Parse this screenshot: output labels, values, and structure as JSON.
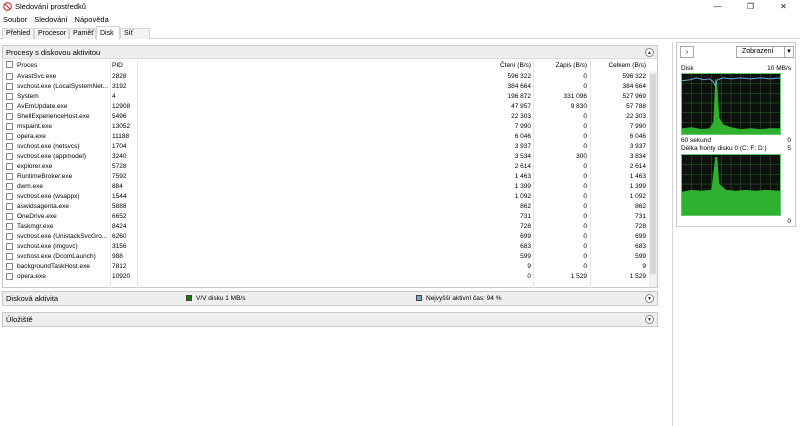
{
  "window": {
    "title": "Sledování prostředků",
    "controls": [
      "—",
      "❐",
      "✕"
    ]
  },
  "menu": [
    "Soubor",
    "Sledování",
    "Nápověda"
  ],
  "tabs": [
    "Přehled",
    "Procesor",
    "Paměť",
    "Disk",
    "Síť"
  ],
  "active_tab": "Disk",
  "processes_section": {
    "title": "Procesy s diskovou aktivitou",
    "columns": {
      "process": "Proces",
      "pid": "PID",
      "read": "Čtení (B/s)",
      "write": "Zápis (B/s)",
      "total": "Celkem (B/s)"
    },
    "rows": [
      {
        "name": "AvastSvc.exe",
        "pid": "2828",
        "read": "596 322",
        "write": "0",
        "total": "596 322"
      },
      {
        "name": "svchost.exe (LocalSystemNet...",
        "pid": "3192",
        "read": "384 664",
        "write": "0",
        "total": "384 664"
      },
      {
        "name": "System",
        "pid": "4",
        "read": "196 872",
        "write": "331 096",
        "total": "527 969"
      },
      {
        "name": "AvEmUpdate.exe",
        "pid": "12908",
        "read": "47 957",
        "write": "9 830",
        "total": "57 788"
      },
      {
        "name": "ShellExperienceHost.exe",
        "pid": "5496",
        "read": "22 303",
        "write": "0",
        "total": "22 303"
      },
      {
        "name": "mspaint.exe",
        "pid": "13052",
        "read": "7 990",
        "write": "0",
        "total": "7 990"
      },
      {
        "name": "opera.exe",
        "pid": "11188",
        "read": "6 046",
        "write": "0",
        "total": "6 046"
      },
      {
        "name": "svchost.exe (netsvcs)",
        "pid": "1704",
        "read": "3 937",
        "write": "0",
        "total": "3 937"
      },
      {
        "name": "svchost.exe (appmodel)",
        "pid": "3240",
        "read": "3 534",
        "write": "300",
        "total": "3 834"
      },
      {
        "name": "explorer.exe",
        "pid": "5728",
        "read": "2 614",
        "write": "0",
        "total": "2 614"
      },
      {
        "name": "RuntimeBroker.exe",
        "pid": "7592",
        "read": "1 463",
        "write": "0",
        "total": "1 463"
      },
      {
        "name": "dwm.exe",
        "pid": "884",
        "read": "1 399",
        "write": "0",
        "total": "1 399"
      },
      {
        "name": "svchost.exe (wsappx)",
        "pid": "1544",
        "read": "1 092",
        "write": "0",
        "total": "1 092"
      },
      {
        "name": "aswidsagenta.exe",
        "pid": "5888",
        "read": "862",
        "write": "0",
        "total": "862"
      },
      {
        "name": "OneDrive.exe",
        "pid": "6652",
        "read": "731",
        "write": "0",
        "total": "731"
      },
      {
        "name": "Taskmgr.exe",
        "pid": "8424",
        "read": "728",
        "write": "0",
        "total": "728"
      },
      {
        "name": "svchost.exe (UnistackSvcGro...",
        "pid": "6260",
        "read": "699",
        "write": "0",
        "total": "699"
      },
      {
        "name": "svchost.exe (imgsvc)",
        "pid": "3156",
        "read": "683",
        "write": "0",
        "total": "683"
      },
      {
        "name": "svchost.exe (DcomLaunch)",
        "pid": "988",
        "read": "599",
        "write": "0",
        "total": "599"
      },
      {
        "name": "backgroundTaskHost.exe",
        "pid": "7812",
        "read": "9",
        "write": "0",
        "total": "9"
      },
      {
        "name": "opera.exe",
        "pid": "10920",
        "read": "0",
        "write": "1 529",
        "total": "1 529"
      }
    ]
  },
  "disk_activity_section": {
    "title": "Disková aktivita",
    "legend1": "V/V disku 1 MB/s",
    "legend1_color": "#1a7a1a",
    "legend2": "Nejvyšší aktivní čas: 94 %",
    "legend2_color": "#6fa8e0"
  },
  "storage_section": {
    "title": "Úložiště"
  },
  "right_panel": {
    "view_button": "Zobrazení",
    "graph1": {
      "title": "Disk",
      "max": "10 MB/s",
      "bottom_left": "60 sekund",
      "bottom_right": "0"
    },
    "graph2": {
      "title": "Délka fronty disku 0 (C: F: D:)",
      "max": "5",
      "bottom_right": "0"
    }
  }
}
